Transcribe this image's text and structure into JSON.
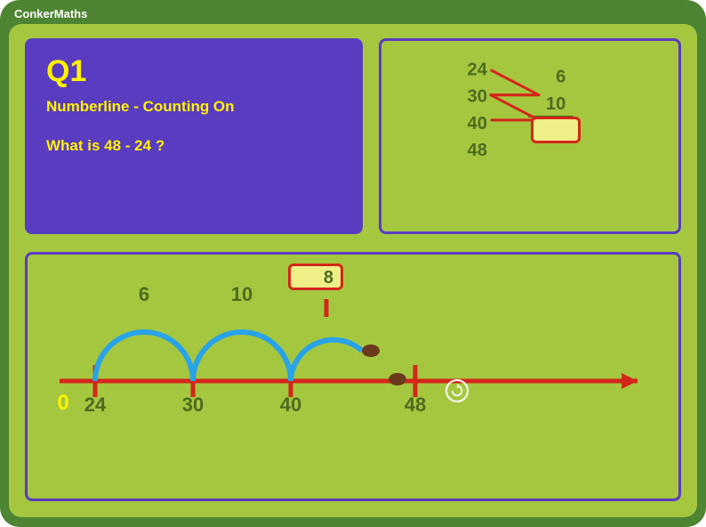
{
  "brand": "ConkerMaths",
  "question": {
    "number": "Q1",
    "title": "Numberline - Counting On",
    "text": "What is 48 - 24 ?"
  },
  "working": {
    "left_col": [
      "24",
      "30",
      "40",
      "48"
    ],
    "right_col": [
      "6",
      "10"
    ],
    "answer_input": ""
  },
  "numberline": {
    "start_label": "0",
    "ticks": [
      "24",
      "30",
      "40",
      "48"
    ],
    "jumps": [
      "6",
      "10"
    ],
    "current_input": "8"
  },
  "colors": {
    "outer": "#4d8533",
    "panel": "#a5c73f",
    "purple": "#5a3cc1",
    "yellow": "#fff200",
    "red": "#d4261a",
    "blue": "#29a3e8",
    "olive": "#4d6b1f",
    "input_bg": "#eef087"
  }
}
